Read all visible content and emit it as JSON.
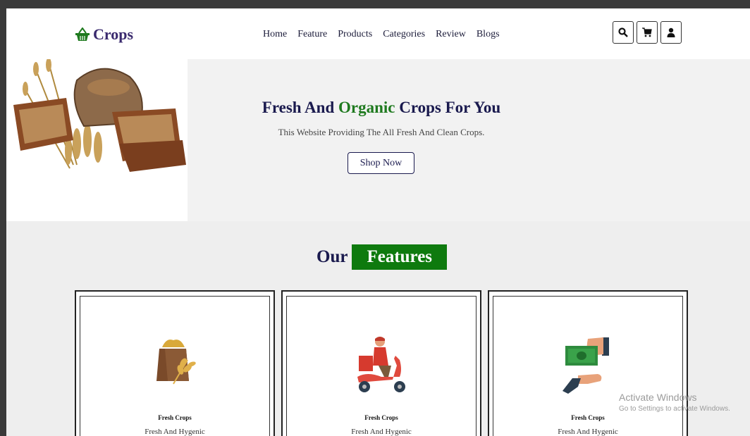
{
  "header": {
    "brand": "Crops",
    "nav": [
      "Home",
      "Feature",
      "Products",
      "Categories",
      "Review",
      "Blogs"
    ],
    "icons": [
      "search-icon",
      "cart-icon",
      "user-icon"
    ]
  },
  "hero": {
    "title_part1": "Fresh And ",
    "title_highlight": "Organic",
    "title_part2": " Crops For You",
    "subtitle": "This Website Providing The All Fresh And Clean Crops.",
    "button": "Shop Now"
  },
  "features": {
    "heading_plain": "Our",
    "heading_boxed": "Features",
    "cards": [
      {
        "icon": "grain-sack-icon",
        "title": "Fresh Crops",
        "subtitle": "Fresh And Hygenic"
      },
      {
        "icon": "delivery-scooter-icon",
        "title": "Fresh Crops",
        "subtitle": "Fresh And Hygenic"
      },
      {
        "icon": "money-payment-icon",
        "title": "Fresh Crops",
        "subtitle": "Fresh And Hygenic"
      }
    ]
  },
  "watermark": {
    "line1": "Activate Windows",
    "line2": "Go to Settings to activate Windows."
  },
  "colors": {
    "accent_green": "#0e7a0e",
    "navy": "#1a1a4e",
    "brand_purple": "#3a2a6e"
  }
}
